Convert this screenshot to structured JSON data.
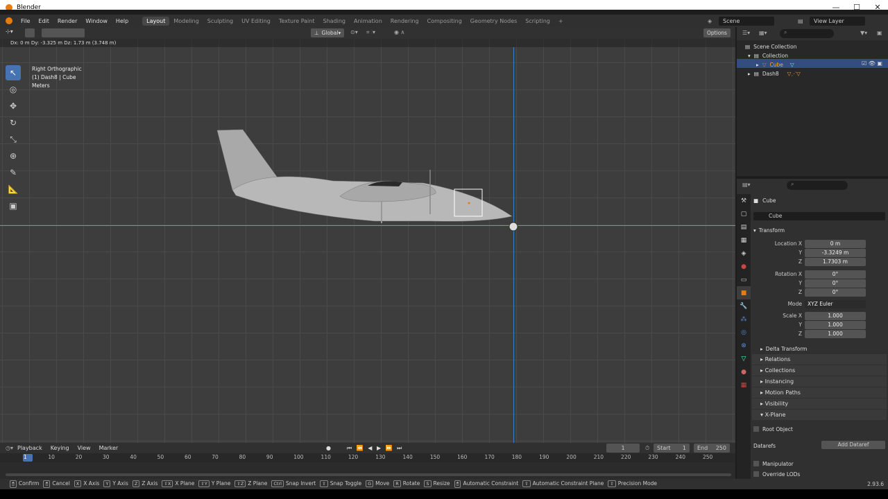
{
  "window": {
    "title": "Blender"
  },
  "menu": [
    "File",
    "Edit",
    "Render",
    "Window",
    "Help"
  ],
  "workspaces": [
    "Layout",
    "Modeling",
    "Sculpting",
    "UV Editing",
    "Texture Paint",
    "Shading",
    "Animation",
    "Rendering",
    "Compositing",
    "Geometry Nodes",
    "Scripting"
  ],
  "scene": {
    "scene_label": "Scene",
    "view_layer": "View Layer"
  },
  "viewport": {
    "orientation": "Global",
    "options": "Options",
    "op_info": "Dx: 0 m   Dy: -3.325 m   Dz: 1.73 m (3.748 m)",
    "view_name": "Right Orthographic",
    "object_info": "(1) Dash8 | Cube",
    "units": "Meters"
  },
  "outliner": {
    "root": "Scene Collection",
    "collection": "Collection",
    "items": [
      "Cube",
      "Dash8"
    ]
  },
  "properties": {
    "object_name": "Cube",
    "data_name": "Cube",
    "transform": "Transform",
    "loc_label": "Location X",
    "loc": [
      "0 m",
      "-3.3249 m",
      "1.7303 m"
    ],
    "rot_label": "Rotation X",
    "rot": [
      "0°",
      "0°",
      "0°"
    ],
    "mode_label": "Mode",
    "mode": "XYZ Euler",
    "scale_label": "Scale X",
    "scale": [
      "1.000",
      "1.000",
      "1.000"
    ],
    "y": "Y",
    "z": "Z",
    "delta": "Delta Transform",
    "panels": [
      "Relations",
      "Collections",
      "Instancing",
      "Motion Paths",
      "Visibility",
      "X-Plane"
    ],
    "root_object": "Root Object",
    "datarefs": "Datarefs",
    "add_dataref": "Add Dataref",
    "manipulator": "Manipulator",
    "override_lods": "Override LODs"
  },
  "timeline": {
    "menus": [
      "Playback",
      "Keying",
      "View",
      "Marker"
    ],
    "frame": "1",
    "start_label": "Start",
    "start": "1",
    "end_label": "End",
    "end": "250",
    "ticks": [
      "1",
      "10",
      "20",
      "30",
      "40",
      "50",
      "60",
      "70",
      "80",
      "90",
      "100",
      "110",
      "120",
      "130",
      "140",
      "150",
      "160",
      "170",
      "180",
      "190",
      "200",
      "210",
      "220",
      "230",
      "240",
      "250"
    ]
  },
  "status": {
    "items": [
      "Confirm",
      "Cancel",
      "X Axis",
      "Y Axis",
      "Z Axis",
      "X Plane",
      "Y Plane",
      "Z Plane",
      "Snap Invert",
      "Snap Toggle",
      "Move",
      "Rotate",
      "Resize",
      "Automatic Constraint",
      "Automatic Constraint Plane",
      "Precision Mode"
    ],
    "keys": [
      "",
      "",
      "X",
      "Y",
      "Z",
      "⇧X",
      "⇧Y",
      "⇧Z",
      "Ctrl",
      "⇧",
      "G",
      "R",
      "S",
      "",
      "⇧",
      "⇧"
    ],
    "version": "2.93.6"
  },
  "colors": {
    "accent": "#4772b3",
    "selected": "#e87d0d",
    "axis_y": "#7fa22e",
    "axis_z": "#3a7ec6"
  }
}
